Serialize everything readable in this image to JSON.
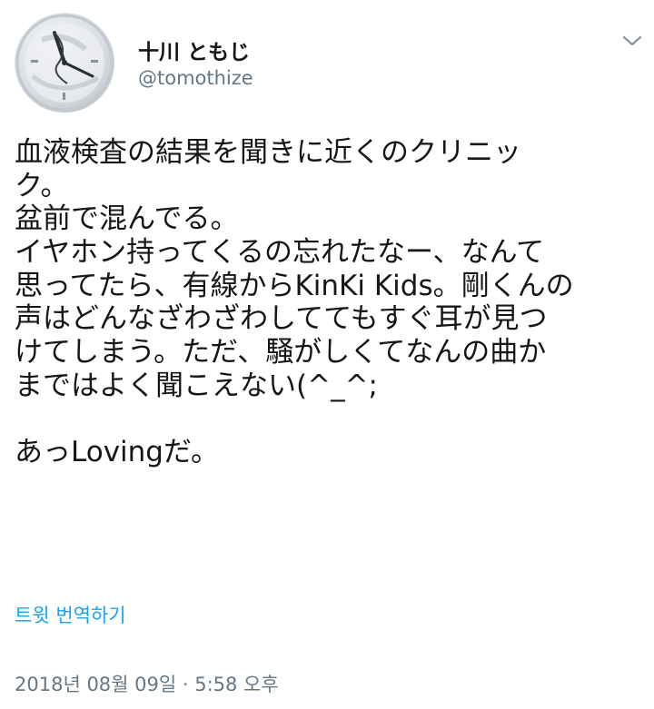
{
  "author": {
    "display_name": "十川 ともじ",
    "username": "@tomothize"
  },
  "tweet": {
    "lines": [
      "血液検査の結果を聞きに近くのクリニッ",
      "ク。",
      "盆前で混んでる。",
      "イヤホン持ってくるの忘れたなー、なんて",
      "思ってたら、有線からKinKi Kids。剛くんの",
      "声はどんなざわざわしててもすぐ耳が見つ",
      "けてしまう。ただ、騒がしくてなんの曲か",
      "まではよく聞こえない(^_^;",
      "",
      "あっLovingだ。"
    ],
    "translate_label": "트윗 번역하기",
    "timestamp": "2018년 08월 09일 · 5:58 오후"
  },
  "icons": {
    "menu": "chevron-down-icon",
    "avatar": "clock-photo"
  }
}
